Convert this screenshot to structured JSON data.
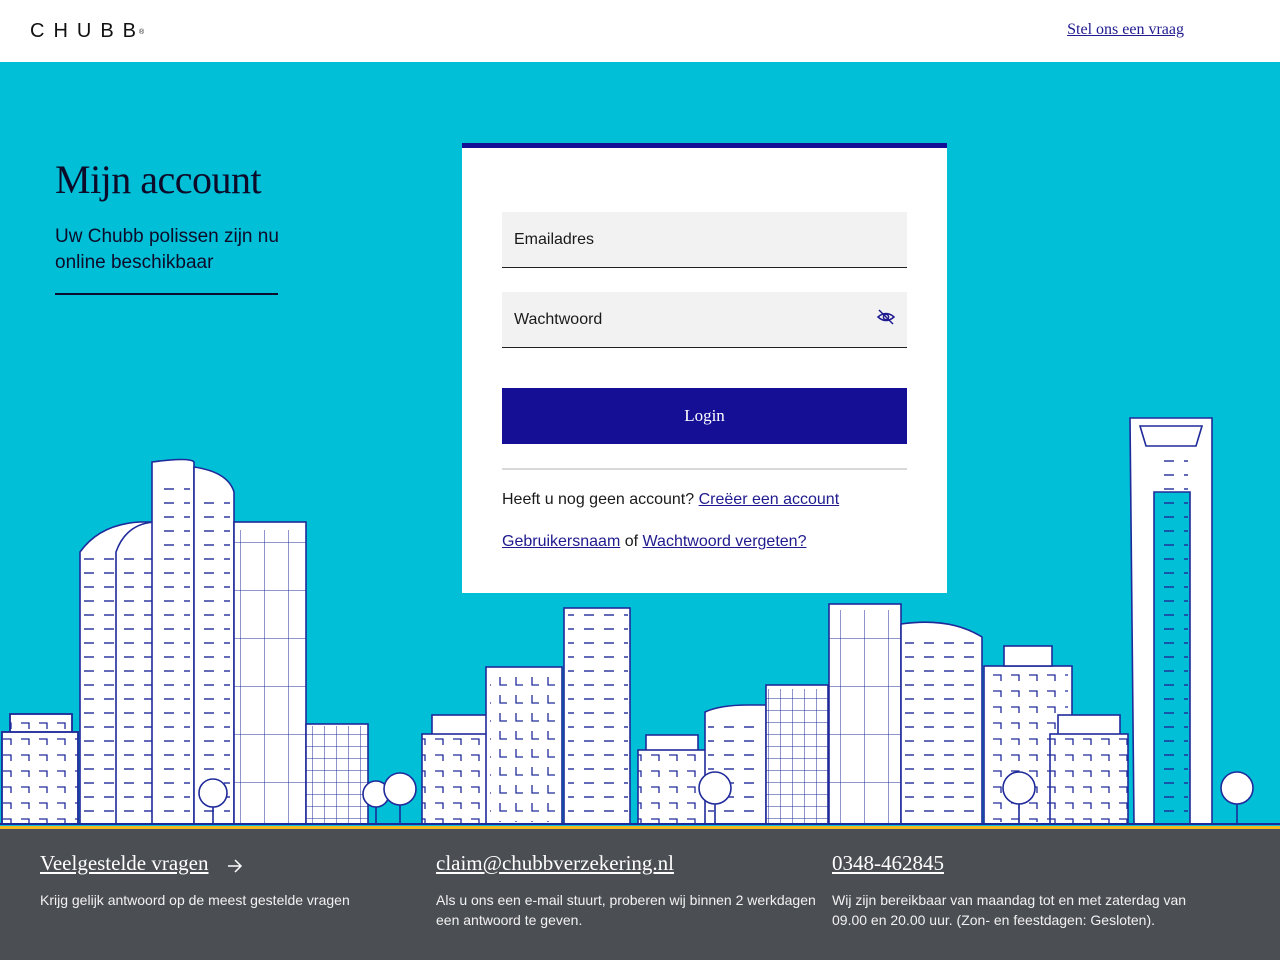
{
  "header": {
    "logo_text": "CHUBB",
    "logo_mark": "®",
    "ask_link": "Stel ons een vraag"
  },
  "intro": {
    "title": "Mijn account",
    "subtitle": "Uw Chubb polissen zijn nu online beschikbaar"
  },
  "login_form": {
    "email_placeholder": "Emailadres",
    "password_placeholder": "Wachtwoord",
    "password_toggle_icon": "eye-slash-icon",
    "login_button": "Login",
    "no_account_text": "Heeft u nog geen account?",
    "create_account_link": "Creëer een account",
    "username_link": "Gebruikersnaam",
    "or_text": "of",
    "forgot_password_link": "Wachtwoord vergeten?"
  },
  "footer": {
    "faq": {
      "title": "Veelgestelde vragen",
      "icon": "arrow-right-icon",
      "text": "Krijg gelijk antwoord op de meest gestelde vragen"
    },
    "email": {
      "title": "claim@chubbverzekering.nl",
      "text": "Als u ons een e-mail stuurt, proberen wij binnen 2 werkdagen een antwoord te geven."
    },
    "phone": {
      "title": "0348-462845",
      "text": "Wij zijn bereikbaar van maandag tot en met zaterdag van 09.00 en 20.00 uur. (Zon- en feestdagen: Gesloten)."
    }
  },
  "colors": {
    "hero_bg": "#00bfd6",
    "brand_blue": "#150f96",
    "footer_bg": "#4b4e53",
    "footer_accent": "#f3b81f",
    "link": "#1f1a8f"
  }
}
